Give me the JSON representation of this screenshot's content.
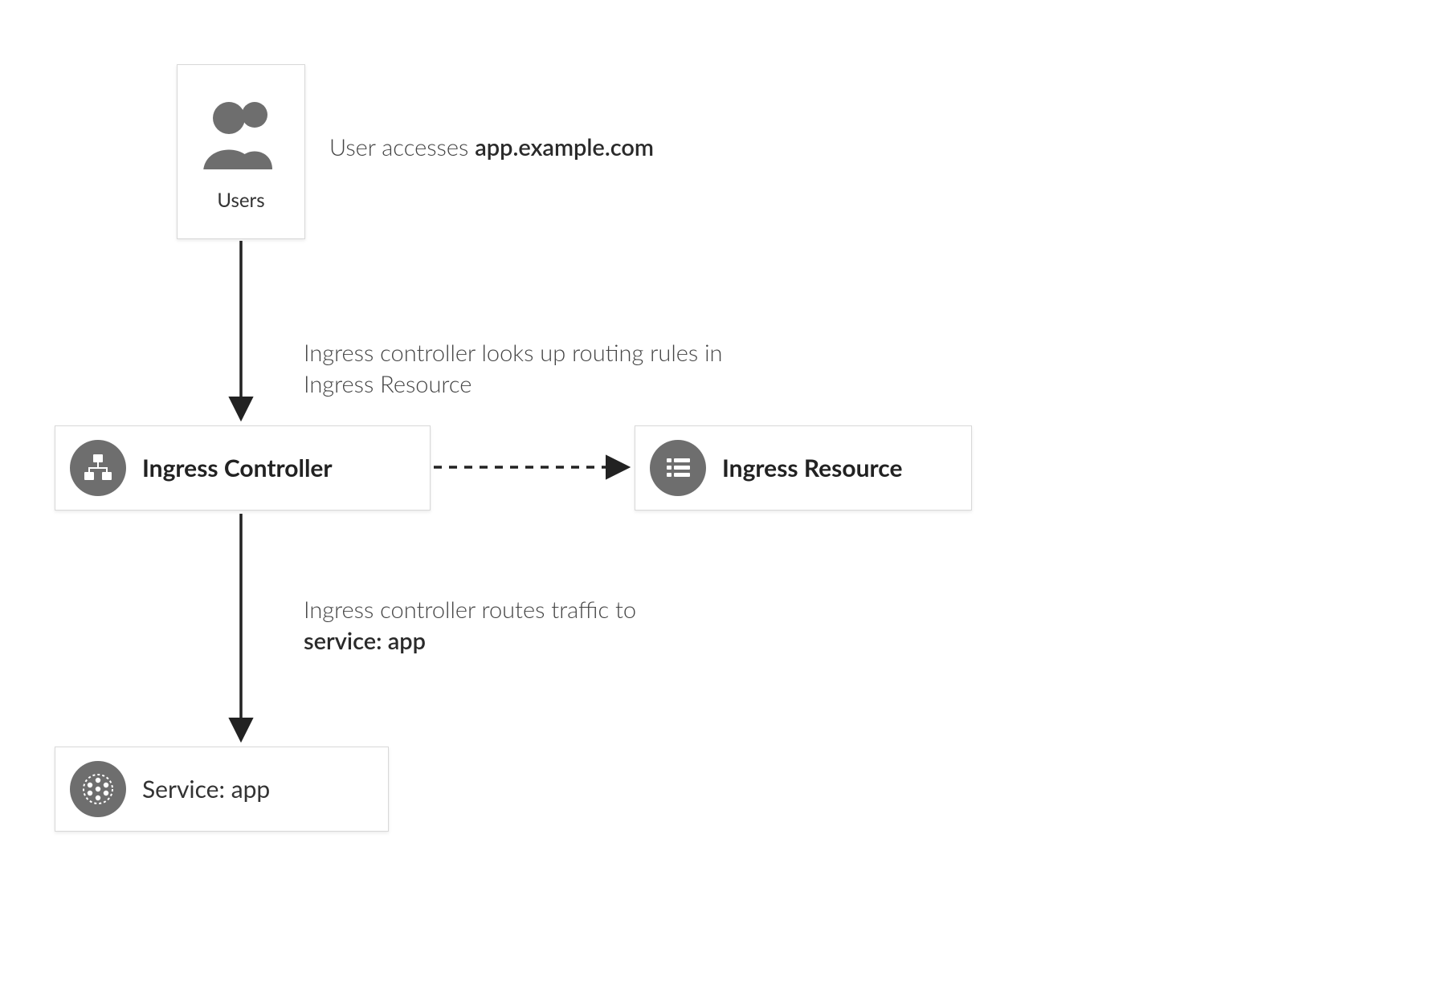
{
  "nodes": {
    "users": {
      "label": "Users"
    },
    "ingress_controller": {
      "label": "Ingress Controller"
    },
    "ingress_resource": {
      "label": "Ingress Resource"
    },
    "service": {
      "label_prefix": "Service: ",
      "label_value": "app"
    }
  },
  "annotations": {
    "access_prefix": "User accesses ",
    "access_host": "app.example.com",
    "lookup": "Ingress controller looks up routing rules in Ingress Resource",
    "route_prefix": "Ingress controller routes traffic to ",
    "route_target": "service: app"
  }
}
